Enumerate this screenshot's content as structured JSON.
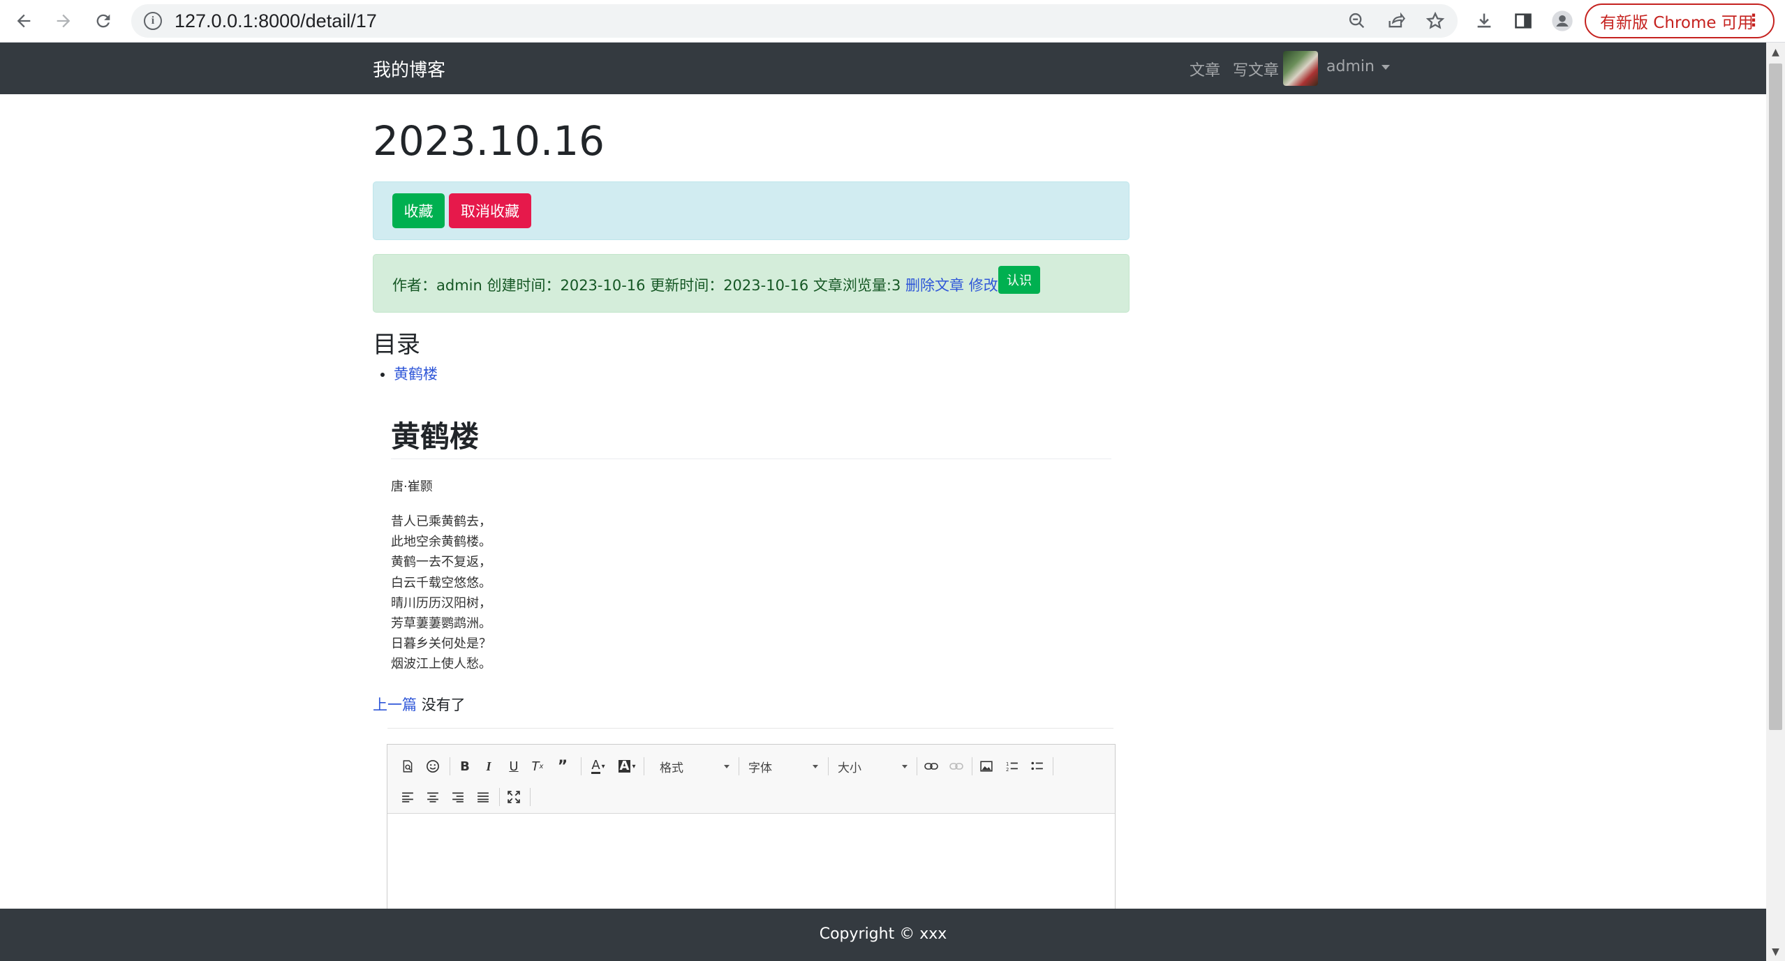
{
  "browser": {
    "url": "127.0.0.1:8000/detail/17",
    "update_label": "有新版 Chrome 可用",
    "icons": {
      "back": "back-arrow-icon",
      "forward": "forward-arrow-icon",
      "reload": "reload-icon",
      "info": "site-info-icon",
      "zoom": "zoom-out-icon",
      "share": "share-icon",
      "bookmark": "star-icon",
      "download": "download-icon",
      "sidepanel": "side-panel-icon",
      "profile": "profile-icon",
      "menu": "more-vert-icon"
    }
  },
  "navbar": {
    "brand": "我的博客",
    "links": [
      "文章",
      "写文章"
    ],
    "user": "admin"
  },
  "post": {
    "title": "2023.10.16",
    "collect_label": "收藏",
    "uncollect_label": "取消收藏",
    "meta": "作者：admin 创建时间：2023-10-16 更新时间：2023-10-16 文章浏览量:3",
    "delete_label": "删除文章",
    "edit_label": "修改文章",
    "recognize_label": "认识"
  },
  "toc": {
    "heading": "目录",
    "items": [
      "黄鹤楼"
    ]
  },
  "article": {
    "heading": "黄鹤楼",
    "author": "唐·崔颢",
    "lines": [
      "昔人已乘黄鹤去，",
      "此地空余黄鹤楼。",
      "黄鹤一去不复返，",
      "白云千载空悠悠。",
      "晴川历历汉阳树，",
      "芳草萋萋鹦鹉洲。",
      "日暮乡关何处是？",
      "烟波江上使人愁。"
    ]
  },
  "pager": {
    "prev_label": "上一篇",
    "next_text": "没有了"
  },
  "editor": {
    "format_label": "格式",
    "font_label": "字体",
    "size_label": "大小"
  },
  "footer": {
    "copyright": "Copyright © xxx"
  },
  "colors": {
    "navbar": "#343a40",
    "success": "#00b050",
    "danger": "#e6194b",
    "link": "#2f57d8",
    "info_bg": "#d1ecf1",
    "success_bg": "#d4edda"
  }
}
